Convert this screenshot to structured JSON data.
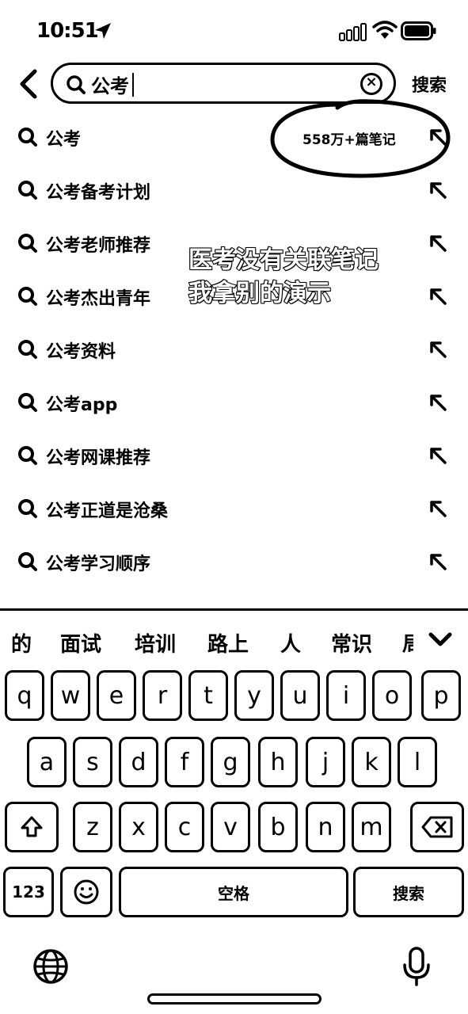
{
  "status": {
    "time": "10:51"
  },
  "search": {
    "query": "公考",
    "submit_label": "搜索"
  },
  "suggestions": [
    {
      "text": "公考",
      "meta": "558万+篇笔记"
    },
    {
      "text": "公考备考计划"
    },
    {
      "text": "公考老师推荐"
    },
    {
      "text": "公考杰出青年"
    },
    {
      "text": "公考资料"
    },
    {
      "text": "公考app"
    },
    {
      "text": "公考网课推荐"
    },
    {
      "text": "公考正道是沧桑"
    },
    {
      "text": "公考学习顺序"
    }
  ],
  "overlay": {
    "line1": "医考没有关联笔记",
    "line2": "我拿别的演示"
  },
  "keyboard": {
    "candidates": [
      "的",
      "面试",
      "培训",
      "路上",
      "人",
      "常识",
      "局"
    ],
    "row1": [
      "q",
      "w",
      "e",
      "r",
      "t",
      "y",
      "u",
      "i",
      "o",
      "p"
    ],
    "row2": [
      "a",
      "s",
      "d",
      "f",
      "g",
      "h",
      "j",
      "k",
      "l"
    ],
    "row3": [
      "z",
      "x",
      "c",
      "v",
      "b",
      "n",
      "m"
    ],
    "numbers_label": "123",
    "space_label": "空格",
    "action_label": "搜索"
  },
  "icons": {
    "back": "chevron-left-icon",
    "search": "magnifier-icon",
    "clear": "clear-circle-icon",
    "fill": "arrow-up-left-icon",
    "shift": "shift-icon",
    "delete": "backspace-icon",
    "emoji": "emoji-icon",
    "globe": "globe-icon",
    "mic": "microphone-icon"
  }
}
